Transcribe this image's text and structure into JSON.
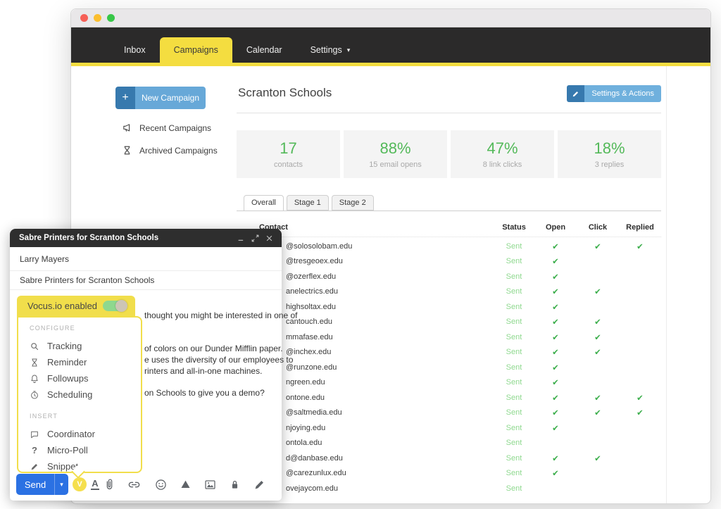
{
  "nav": {
    "tabs": [
      {
        "label": "Inbox",
        "active": false,
        "caret": false
      },
      {
        "label": "Campaigns",
        "active": true,
        "caret": false
      },
      {
        "label": "Calendar",
        "active": false,
        "caret": false
      },
      {
        "label": "Settings",
        "active": false,
        "caret": true
      }
    ]
  },
  "sidebar": {
    "new_campaign_label": "New Campaign",
    "links": [
      {
        "icon": "megaphone",
        "label": "Recent Campaigns"
      },
      {
        "icon": "hourglass",
        "label": "Archived Campaigns"
      }
    ]
  },
  "campaign": {
    "title": "Scranton Schools",
    "settings_button": "Settings & Actions",
    "stats": [
      {
        "value": "17",
        "label": "contacts"
      },
      {
        "value": "88%",
        "label": "15 email opens"
      },
      {
        "value": "47%",
        "label": "8 link clicks"
      },
      {
        "value": "18%",
        "label": "3 replies"
      }
    ],
    "stage_tabs": [
      {
        "label": "Overall",
        "active": true
      },
      {
        "label": "Stage 1",
        "active": false
      },
      {
        "label": "Stage 2",
        "active": false
      }
    ],
    "table": {
      "headers": [
        "Contact",
        "Status",
        "Open",
        "Click",
        "Replied"
      ],
      "rows": [
        {
          "email": "@solosolobam.edu",
          "status": "Sent",
          "open": true,
          "click": true,
          "replied": true
        },
        {
          "email": "@tresgeoex.edu",
          "status": "Sent",
          "open": true,
          "click": false,
          "replied": false
        },
        {
          "email": "@ozerflex.edu",
          "status": "Sent",
          "open": true,
          "click": false,
          "replied": false
        },
        {
          "email": "anelectrics.edu",
          "status": "Sent",
          "open": true,
          "click": true,
          "replied": false
        },
        {
          "email": "highsoltax.edu",
          "status": "Sent",
          "open": true,
          "click": false,
          "replied": false
        },
        {
          "email": "cantouch.edu",
          "status": "Sent",
          "open": true,
          "click": true,
          "replied": false
        },
        {
          "email": "mmafase.edu",
          "status": "Sent",
          "open": true,
          "click": true,
          "replied": false
        },
        {
          "email": "@inchex.edu",
          "status": "Sent",
          "open": true,
          "click": true,
          "replied": false
        },
        {
          "email": "@runzone.edu",
          "status": "Sent",
          "open": true,
          "click": false,
          "replied": false
        },
        {
          "email": "ngreen.edu",
          "status": "Sent",
          "open": true,
          "click": false,
          "replied": false
        },
        {
          "email": "ontone.edu",
          "status": "Sent",
          "open": true,
          "click": true,
          "replied": true
        },
        {
          "email": "@saltmedia.edu",
          "status": "Sent",
          "open": true,
          "click": true,
          "replied": true
        },
        {
          "email": "njoying.edu",
          "status": "Sent",
          "open": true,
          "click": false,
          "replied": false
        },
        {
          "email": "ontola.edu",
          "status": "Sent",
          "open": false,
          "click": false,
          "replied": false
        },
        {
          "email": "d@danbase.edu",
          "status": "Sent",
          "open": true,
          "click": true,
          "replied": false
        },
        {
          "email": "@carezunlux.edu",
          "status": "Sent",
          "open": true,
          "click": false,
          "replied": false
        },
        {
          "email": "ovejaycom.edu",
          "status": "Sent",
          "open": false,
          "click": false,
          "replied": false
        }
      ]
    }
  },
  "compose": {
    "title": "Sabre Printers for Scranton Schools",
    "header_icons": [
      "minimize",
      "expand",
      "close"
    ],
    "recipient": "Larry Mayers",
    "subject": "Sabre Printers for Scranton Schools",
    "body_fragments": [
      "thought you might be interested in one of",
      "of colors on our Dunder Mifflin paper.",
      "e uses the diversity of our employees to",
      "rinters and all-in-one machines.",
      "on Schools to give you a demo?"
    ],
    "vocus_popup": {
      "label": "Vocus.io enabled",
      "enabled": true
    },
    "menu": {
      "sections": [
        {
          "title": "CONFIGURE",
          "items": [
            {
              "icon": "search",
              "label": "Tracking"
            },
            {
              "icon": "hourglass",
              "label": "Reminder"
            },
            {
              "icon": "bell",
              "label": "Followups"
            },
            {
              "icon": "clock",
              "label": "Scheduling"
            }
          ]
        },
        {
          "title": "INSERT",
          "items": [
            {
              "icon": "speech-bubble",
              "label": "Coordinator"
            },
            {
              "icon": "question",
              "label": "Micro-Poll"
            },
            {
              "icon": "pen",
              "label": "Snippet"
            }
          ]
        }
      ]
    },
    "send_label": "Send",
    "toolbar_icons": [
      "vocus",
      "format",
      "attach",
      "link",
      "emoji",
      "drive",
      "image",
      "confidential",
      "pen"
    ]
  },
  "colors": {
    "accent_yellow": "#f4dd40",
    "popup_yellow": "#f1de4b",
    "green": "#53b959",
    "sent_green": "#8fd98f",
    "check_green": "#3cae4c",
    "button_blue": "#67a8d8",
    "button_blue_dark": "#3779ae",
    "send_blue": "#2b71e3",
    "nav_dark": "#2b2a2a"
  }
}
